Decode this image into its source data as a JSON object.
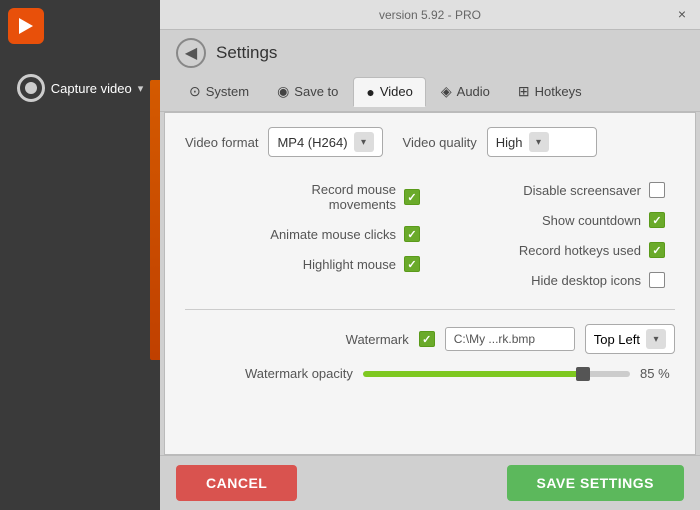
{
  "app": {
    "version": "version 5.92 - PRO",
    "close_btn": "×"
  },
  "sidebar": {
    "capture_label": "Capture video",
    "capture_arrow": "▾"
  },
  "header": {
    "back_icon": "◀",
    "title": "Settings"
  },
  "tabs": [
    {
      "id": "system",
      "label": "System",
      "icon": "⊙"
    },
    {
      "id": "save-to",
      "label": "Save to",
      "icon": "◉"
    },
    {
      "id": "video",
      "label": "Video",
      "icon": "●",
      "active": true
    },
    {
      "id": "audio",
      "label": "Audio",
      "icon": "◈"
    },
    {
      "id": "hotkeys",
      "label": "Hotkeys",
      "icon": "⊞"
    }
  ],
  "video": {
    "format_label": "Video format",
    "format_value": "MP4 (H264)",
    "quality_label": "Video quality",
    "quality_value": "High",
    "options_left": [
      {
        "id": "record-mouse",
        "label": "Record mouse\nmovements",
        "checked": true
      },
      {
        "id": "animate-clicks",
        "label": "Animate mouse clicks",
        "checked": true
      },
      {
        "id": "highlight-mouse",
        "label": "Highlight mouse",
        "checked": true
      }
    ],
    "options_right": [
      {
        "id": "disable-screensaver",
        "label": "Disable screensaver",
        "checked": false
      },
      {
        "id": "show-countdown",
        "label": "Show countdown",
        "checked": true
      },
      {
        "id": "record-hotkeys",
        "label": "Record hotkeys used",
        "checked": true
      },
      {
        "id": "hide-icons",
        "label": "Hide desktop icons",
        "checked": false
      }
    ],
    "watermark_label": "Watermark",
    "watermark_checked": true,
    "watermark_path": "C:\\My ...rk.bmp",
    "watermark_pos": "Top Left",
    "opacity_label": "Watermark opacity",
    "opacity_value": "85 %"
  },
  "footer": {
    "cancel_label": "CANCEL",
    "save_label": "SAVE SETTINGS"
  }
}
